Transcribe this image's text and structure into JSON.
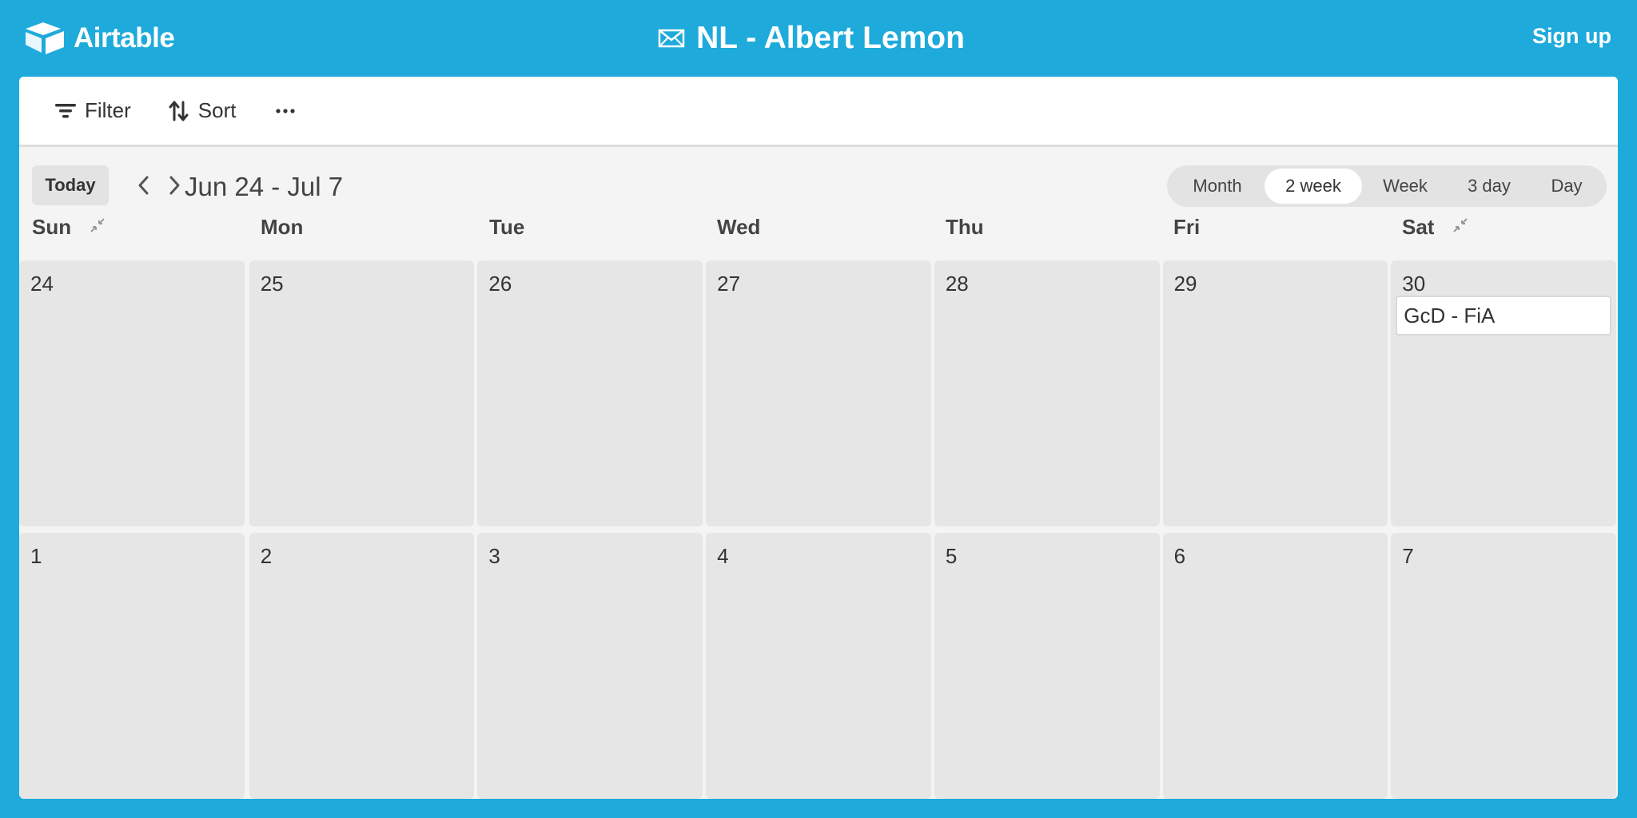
{
  "app": {
    "name": "Airtable"
  },
  "header": {
    "title": "NL - Albert Lemon",
    "signup_label": "Sign up"
  },
  "toolbar": {
    "filter_label": "Filter",
    "sort_label": "Sort"
  },
  "calendar": {
    "today_label": "Today",
    "range_label": "Jun 24 - Jul 7",
    "views": [
      "Month",
      "2 week",
      "Week",
      "3 day",
      "Day"
    ],
    "active_view": "2 week",
    "day_names": [
      "Sun",
      "Mon",
      "Tue",
      "Wed",
      "Thu",
      "Fri",
      "Sat"
    ],
    "weeks": [
      [
        "24",
        "25",
        "26",
        "27",
        "28",
        "29",
        "30"
      ],
      [
        "1",
        "2",
        "3",
        "4",
        "5",
        "6",
        "7"
      ]
    ],
    "events": [
      {
        "label": "GcD - FiA",
        "week": 0,
        "day": 6
      }
    ]
  },
  "colors": {
    "brand_bg": "#1eaadb",
    "panel_bg": "#f4f4f4",
    "cell_bg": "#e6e6e6"
  }
}
